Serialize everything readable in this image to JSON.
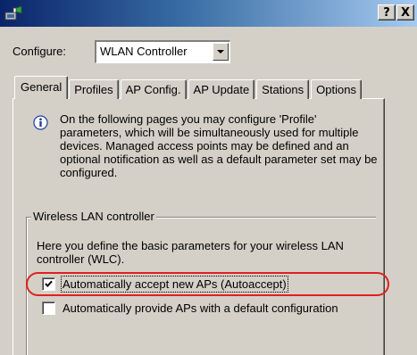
{
  "titlebar": {
    "help_label": "?",
    "close_label": "X",
    "app_icon": "lancom-app-icon"
  },
  "configure": {
    "label": "Configure:",
    "selected_value": "WLAN Controller"
  },
  "tabs": [
    {
      "label": "General",
      "active": true
    },
    {
      "label": "Profiles",
      "active": false
    },
    {
      "label": "AP Config.",
      "active": false
    },
    {
      "label": "AP Update",
      "active": false
    },
    {
      "label": "Stations",
      "active": false
    },
    {
      "label": "Options",
      "active": false
    }
  ],
  "info": {
    "icon": "info-icon",
    "text": "On the following pages you may configure 'Profile' parameters, which will be simultaneously used for multiple devices. Managed access points may be defined and an optional notification as well as a default parameter set may be configured."
  },
  "wlc_group": {
    "title": "Wireless LAN controller",
    "description": "Here you define the basic parameters for your wireless LAN controller (WLC).",
    "options": [
      {
        "label": "Automatically accept new APs (Autoaccept)",
        "checked": true
      },
      {
        "label": "Automatically provide APs with a default configuration",
        "checked": false
      }
    ]
  },
  "colors": {
    "dialog_face": "#d4d0c8",
    "titlebar_start": "#0a246a",
    "titlebar_end": "#a6caf0",
    "highlight_ring": "#e02020"
  }
}
